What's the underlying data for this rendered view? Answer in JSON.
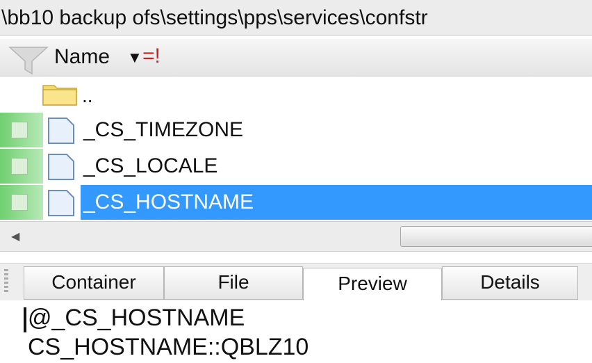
{
  "path_bar": {
    "text": "\\bb10 backup ofs\\settings\\pps\\services\\confstr"
  },
  "column_header": {
    "filter_icon": "filter-funnel-icon",
    "name_label": "Name",
    "sort_icon": "sort-descending-icon",
    "filter_flag": "=!"
  },
  "files": {
    "parent": {
      "label": "..",
      "icon": "folder-icon"
    },
    "rows": [
      {
        "name": "_CS_TIMEZONE",
        "icon": "document-icon",
        "selected": false
      },
      {
        "name": "_CS_LOCALE",
        "icon": "document-icon",
        "selected": false
      },
      {
        "name": "_CS_HOSTNAME",
        "icon": "document-icon",
        "selected": true
      }
    ]
  },
  "tabs": [
    {
      "label": "Container",
      "active": false
    },
    {
      "label": "File",
      "active": false
    },
    {
      "label": "Preview",
      "active": true
    },
    {
      "label": "Details",
      "active": false
    }
  ],
  "preview": {
    "line1": "@_CS_HOSTNAME",
    "line2": "CS_HOSTNAME::QBLZ10"
  },
  "colors": {
    "selection": "#3399ff",
    "check_green": "#6fcf6f",
    "filter_flag": "#d21c1c"
  }
}
